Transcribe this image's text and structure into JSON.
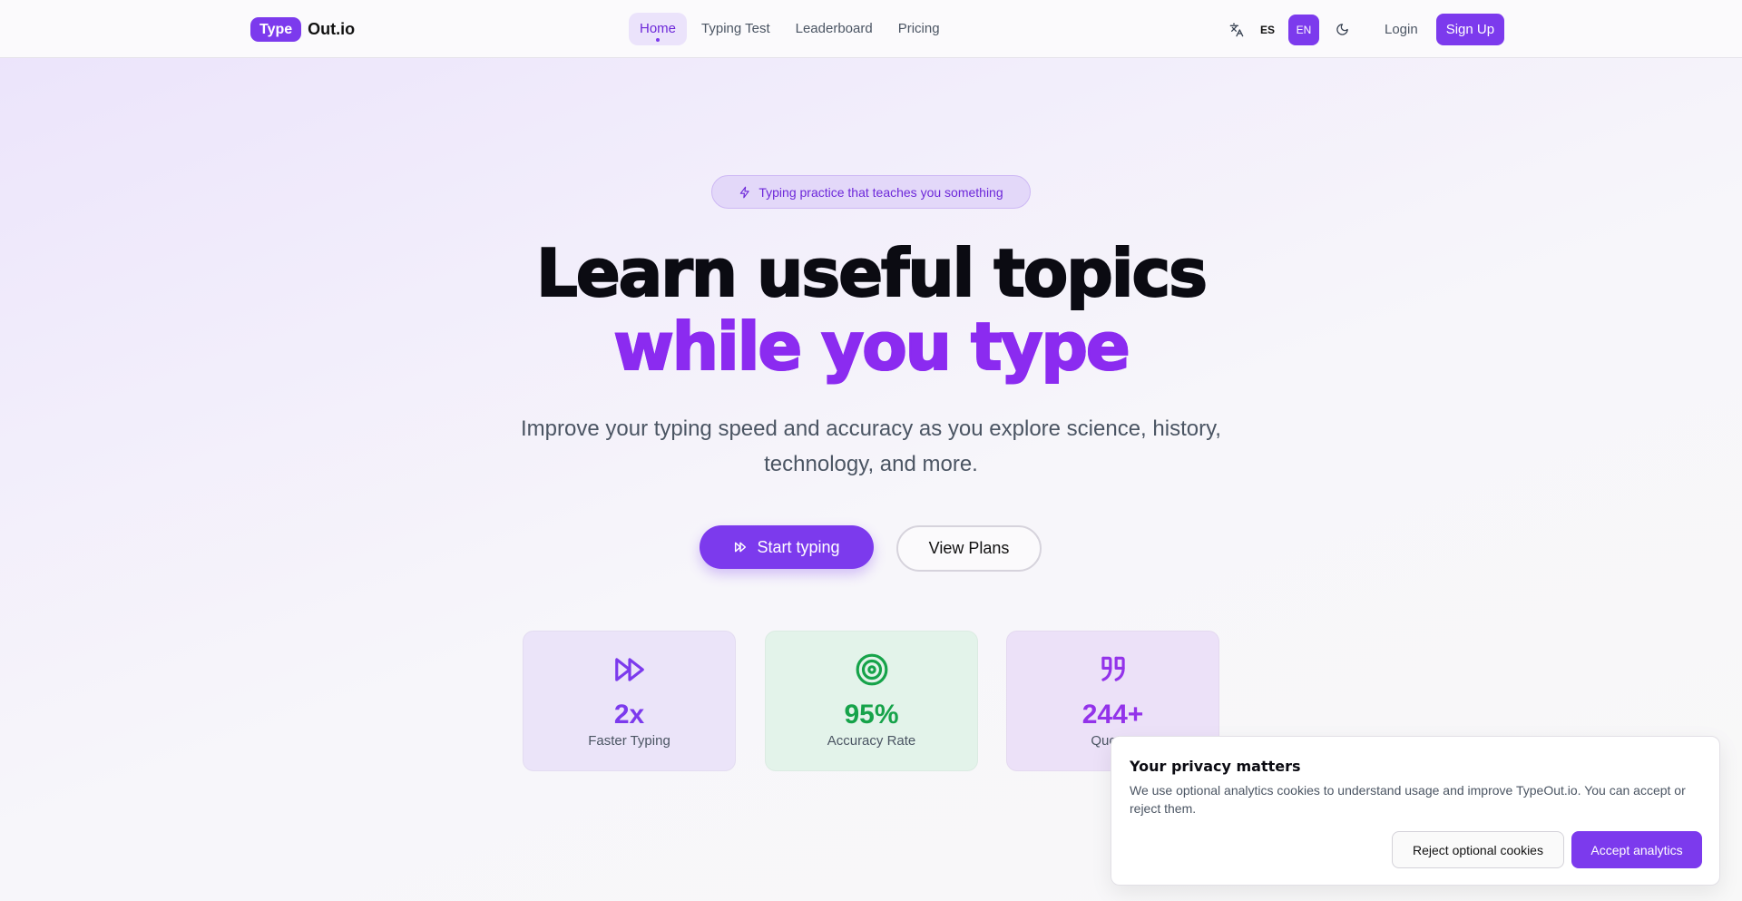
{
  "brand": {
    "badge": "Type",
    "name": "Out.io"
  },
  "nav": {
    "items": [
      {
        "label": "Home",
        "active": true
      },
      {
        "label": "Typing Test"
      },
      {
        "label": "Leaderboard"
      },
      {
        "label": "Pricing"
      }
    ]
  },
  "header_tools": {
    "translate_icon": "translate-icon",
    "lang_es": "ES",
    "lang_en": "EN",
    "theme_icon": "moon-icon",
    "login": "Login",
    "signup": "Sign Up"
  },
  "hero": {
    "pill": "Typing practice that teaches you something",
    "title_line1": "Learn useful topics",
    "title_line2": "while you type",
    "subtitle": "Improve your typing speed and accuracy as you explore science, history, technology, and more.",
    "start_button": "Start typing",
    "plans_button": "View Plans"
  },
  "stats": [
    {
      "icon": "fast-forward-icon",
      "value": "2x",
      "label": "Faster Typing",
      "color": "#7c3aed"
    },
    {
      "icon": "target-icon",
      "value": "95%",
      "label": "Accuracy Rate",
      "color": "#16a34a"
    },
    {
      "icon": "quote-icon",
      "value": "244+",
      "label": "Quotes",
      "color": "#9333ea"
    }
  ],
  "cookie": {
    "title": "Your privacy matters",
    "text": "We use optional analytics cookies to understand usage and improve TypeOut.io. You can accept or reject them.",
    "reject": "Reject optional cookies",
    "accept": "Accept analytics"
  },
  "colors": {
    "accent": "#7c3aed",
    "success": "#16a34a"
  }
}
